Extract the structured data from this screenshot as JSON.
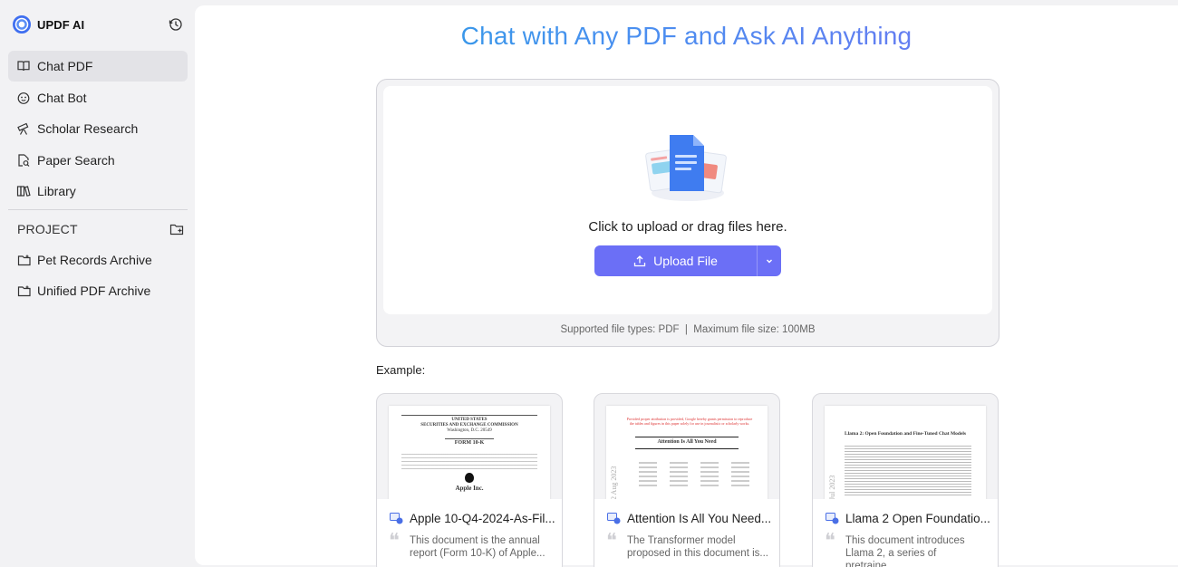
{
  "brand": {
    "name": "UPDF AI"
  },
  "sidebar": {
    "items": [
      {
        "label": "Chat PDF",
        "icon": "book-icon",
        "active": true
      },
      {
        "label": "Chat Bot",
        "icon": "bot-face-icon",
        "active": false
      },
      {
        "label": "Scholar Research",
        "icon": "telescope-icon",
        "active": false
      },
      {
        "label": "Paper Search",
        "icon": "doc-search-icon",
        "active": false
      },
      {
        "label": "Library",
        "icon": "library-icon",
        "active": false
      }
    ],
    "project_label": "PROJECT",
    "projects": [
      {
        "label": "Pet Records Archive"
      },
      {
        "label": "Unified PDF Archive"
      }
    ]
  },
  "main": {
    "headline": "Chat with Any PDF and Ask AI Anything",
    "upload": {
      "hint": "Click to upload or drag files here.",
      "button_label": "Upload File",
      "supported": "Supported file types: PDF  |  Maximum file size: 100MB"
    },
    "example_label": "Example:",
    "examples": [
      {
        "title": "Apple 10-Q4-2024-As-Fil...",
        "desc": "This document is the annual report (Form 10-K) of Apple...",
        "thumb": {
          "l1": "UNITED STATES",
          "l2": "SECURITIES AND EXCHANGE COMMISSION",
          "l3": "Washington, D.C. 20549",
          "form": "FORM 10-K",
          "company": "Apple Inc."
        }
      },
      {
        "title": "Attention Is All You Need...",
        "desc": "The Transformer model proposed in this document is...",
        "thumb": {
          "note": "Provided proper attribution is provided, Google hereby grants permission to reproduce the tables and figures in this paper solely for use in journalistic or scholarly works.",
          "heading": "Attention Is All You Need",
          "side": "2 Aug 2023"
        }
      },
      {
        "title": "Llama 2 Open Foundatio...",
        "desc": "This document introduces Llama 2, a series of pretraine...",
        "thumb": {
          "heading": "Llama 2: Open Foundation and Fine-Tuned Chat Models",
          "side": "Jul 2023"
        }
      }
    ]
  },
  "colors": {
    "accent": "#6b6ff6",
    "headline_start": "#22a3e0",
    "headline_end": "#7c6cf2",
    "sidebar_bg": "#f2f2f4"
  }
}
